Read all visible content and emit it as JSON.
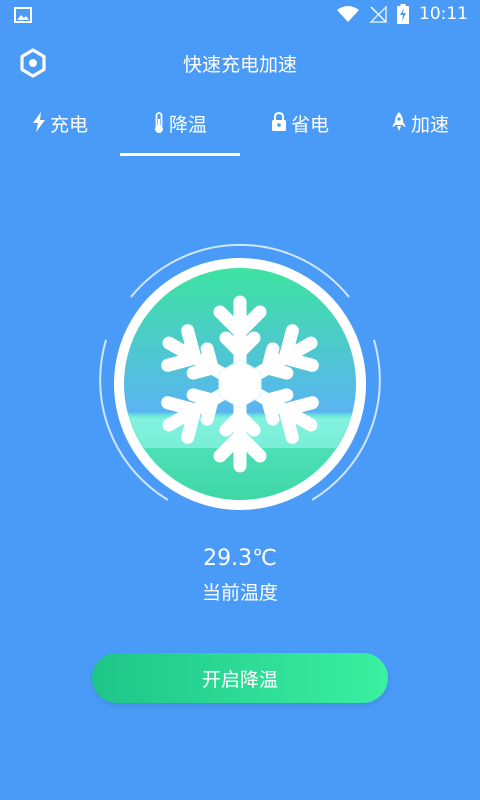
{
  "status": {
    "time": "10:11"
  },
  "header": {
    "title": "快速充电加速"
  },
  "tabs": [
    {
      "label": "充电",
      "icon": "lightning-icon"
    },
    {
      "label": "降温",
      "icon": "thermometer-icon",
      "active": true
    },
    {
      "label": "省电",
      "icon": "lock-icon"
    },
    {
      "label": "加速",
      "icon": "rocket-icon"
    }
  ],
  "gauge": {
    "icon": "snowflake-icon"
  },
  "temperature": {
    "value": "29.3℃",
    "label": "当前温度"
  },
  "action": {
    "label": "开启降温"
  },
  "colors": {
    "background": "#4a9bf8",
    "accent_start": "#1ec589",
    "accent_end": "#3bf0a1"
  }
}
